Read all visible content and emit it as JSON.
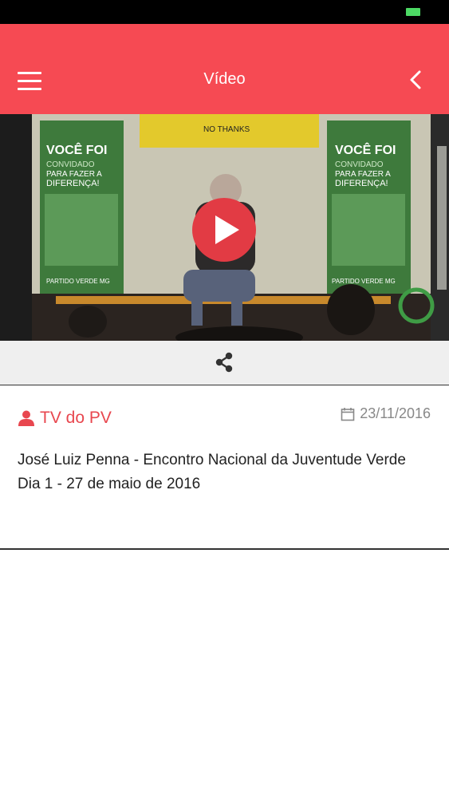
{
  "header": {
    "title": "Vídeo"
  },
  "post": {
    "author": "TV do PV",
    "date": "23/11/2016",
    "description_line1": "José Luiz Penna - Encontro Nacional da Juventude Verde",
    "description_line2": "Dia 1 - 27 de maio de 2016"
  },
  "video_banner": {
    "left_banner": [
      "VOCÊ FOI",
      "CONVIDADO",
      "PARA FAZER A",
      "DIFERENÇA!"
    ],
    "right_banner": [
      "VOCÊ FOI",
      "CONVIDADO",
      "PARA FAZER A",
      "DIFERENÇA!"
    ],
    "flag_text": "NO THANKS",
    "party_text": "PARTIDO VERDE MG"
  },
  "colors": {
    "accent": "#f64a53",
    "play": "#e23b44",
    "author": "#e8474f"
  }
}
